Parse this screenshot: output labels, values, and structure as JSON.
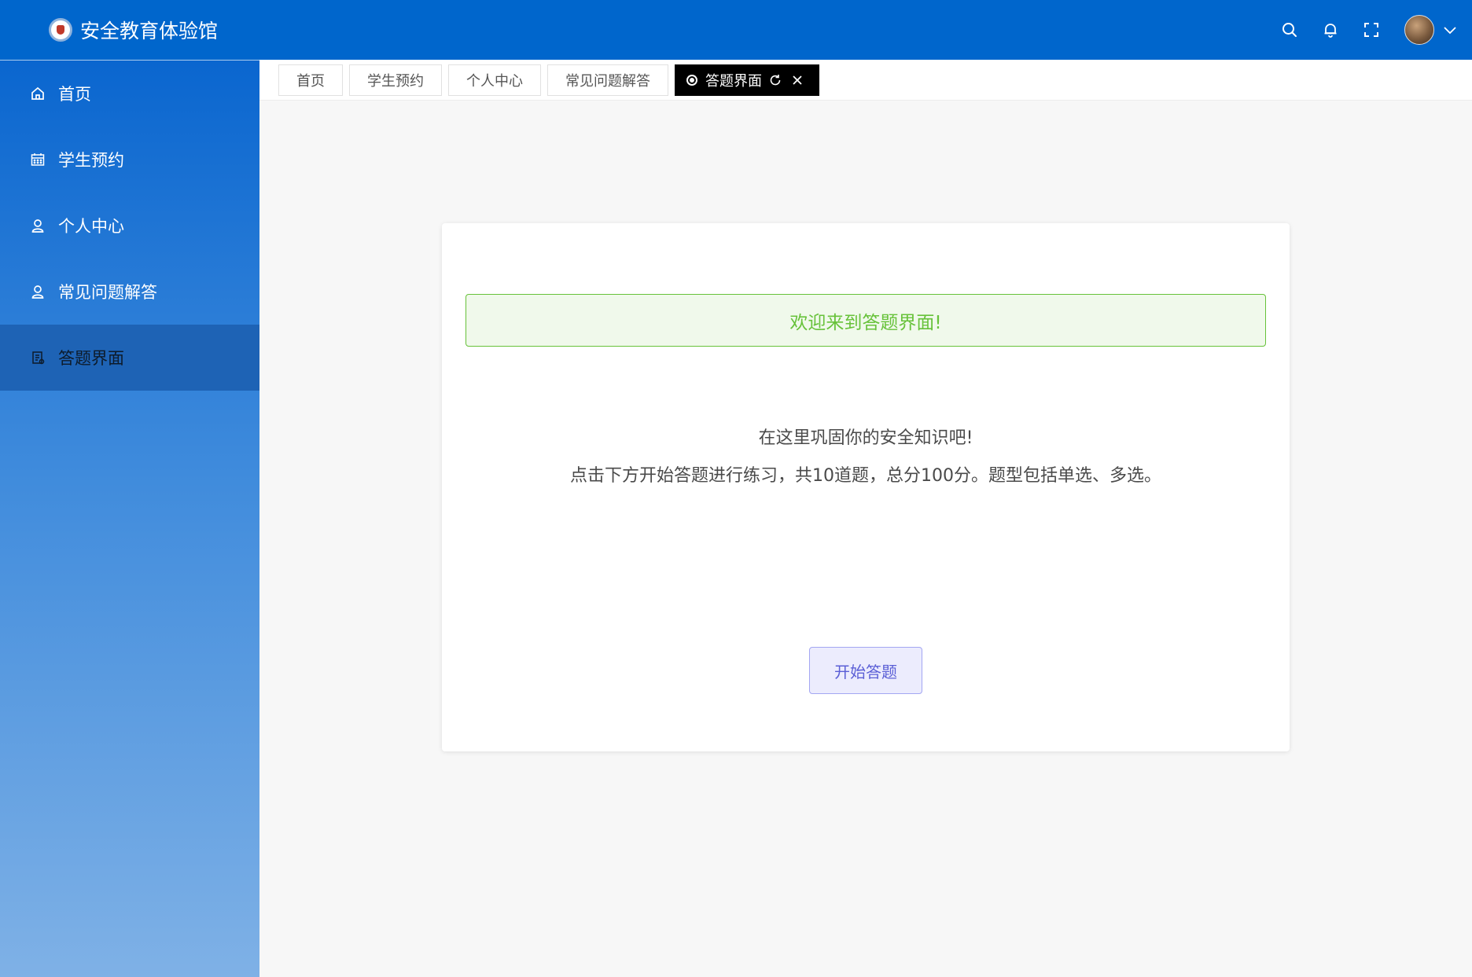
{
  "app": {
    "title": "安全教育体验馆"
  },
  "header": {
    "icons": [
      "search-icon",
      "bell-icon",
      "fullscreen-icon",
      "avatar",
      "chevron-down-icon"
    ]
  },
  "sidebar": {
    "items": [
      {
        "label": "首页",
        "icon": "home-icon",
        "active": false
      },
      {
        "label": "学生预约",
        "icon": "calendar-icon",
        "active": false
      },
      {
        "label": "个人中心",
        "icon": "user-icon",
        "active": false
      },
      {
        "label": "常见问题解答",
        "icon": "user-icon",
        "active": false
      },
      {
        "label": "答题界面",
        "icon": "document-icon",
        "active": true
      }
    ]
  },
  "tabs": {
    "items": [
      {
        "label": "首页"
      },
      {
        "label": "学生预约"
      },
      {
        "label": "个人中心"
      },
      {
        "label": "常见问题解答"
      },
      {
        "label": "答题界面",
        "active": true
      }
    ]
  },
  "main": {
    "alert": "欢迎来到答题界面!",
    "line1": "在这里巩固你的安全知识吧!",
    "line2": "点击下方开始答题进行练习，共10道题，总分100分。题型包括单选、多选。",
    "start_button": "开始答题"
  },
  "colors": {
    "header": "#0066cc",
    "active_tab": "#000000",
    "alert_green": "#67c23a",
    "button_purple": "#5b5fd6"
  }
}
